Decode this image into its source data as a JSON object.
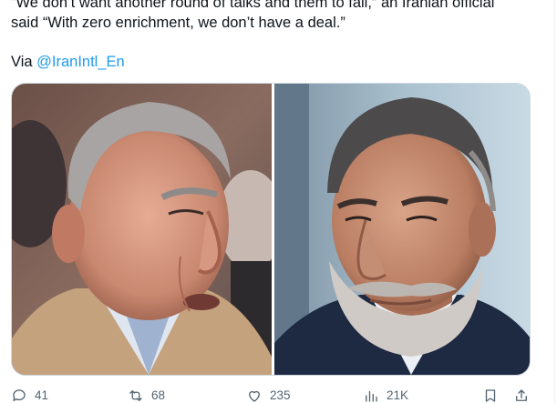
{
  "tweet": {
    "text_line_1": "“We don’t want another round of talks and them to fail,” an Iranian official",
    "text_line_2": "said “With zero enrichment, we don’t have a deal.”",
    "via_prefix": "Via ",
    "via_handle": "@IranIntl_En"
  },
  "media": {
    "photos": [
      "left-photo",
      "right-photo"
    ]
  },
  "actions": {
    "replies": "41",
    "retweets": "68",
    "likes": "235",
    "views": "21K"
  },
  "colors": {
    "text": "#0f1419",
    "muted": "#536471",
    "link": "#1d9bf0",
    "border": "#cfd9de"
  }
}
